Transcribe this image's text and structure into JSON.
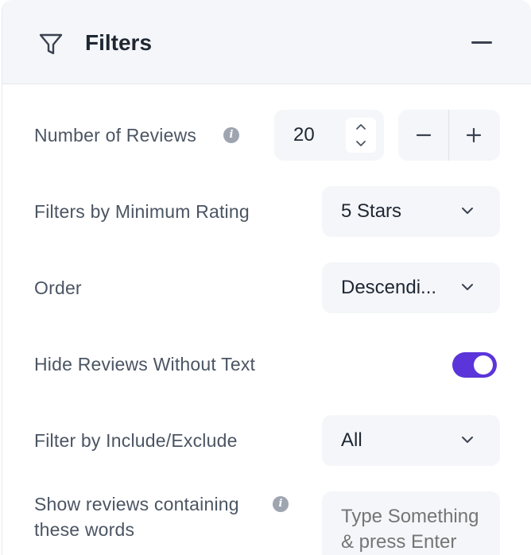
{
  "header": {
    "title": "Filters",
    "icons": {
      "filter": "funnel-icon",
      "collapse": "minus-icon"
    }
  },
  "fields": {
    "number_of_reviews": {
      "label": "Number of Reviews",
      "info_icon": "info-icon",
      "value": "20"
    },
    "min_rating": {
      "label": "Filters by Minimum Rating",
      "selected": "5 Stars"
    },
    "order": {
      "label": "Order",
      "selected": "Descendi..."
    },
    "hide_without_text": {
      "label": "Hide Reviews Without Text",
      "enabled": true
    },
    "include_exclude": {
      "label": "Filter by Include/Exclude",
      "selected": "All"
    },
    "containing_words": {
      "label_line1": "Show reviews containing",
      "label_line2": "these words",
      "info_icon": "info-icon",
      "placeholder": "Type Something & press Enter"
    }
  },
  "colors": {
    "toggle_on": "#5b35d9",
    "field_bg": "#f4f6f9",
    "label_text": "#4b5563",
    "placeholder_text": "#a3aab5"
  }
}
